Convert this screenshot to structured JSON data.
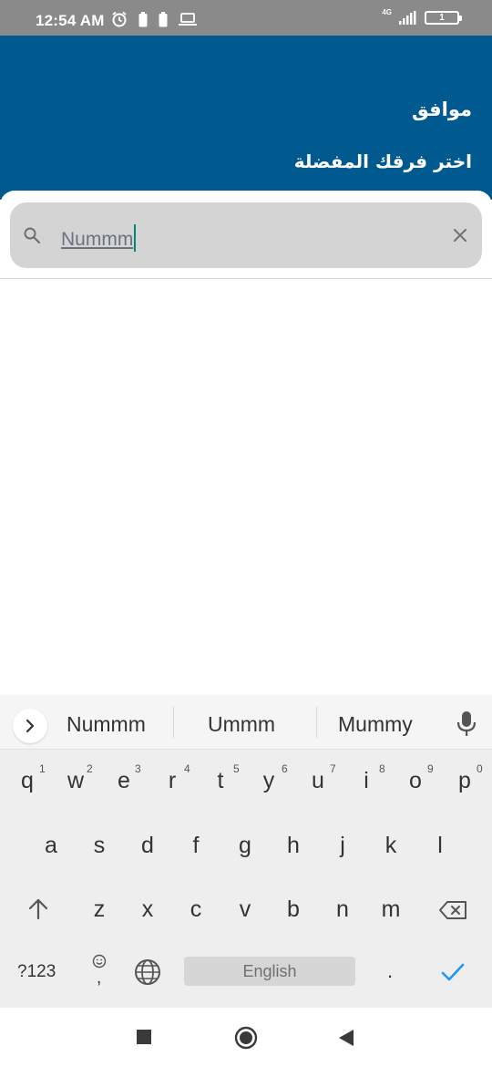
{
  "status_bar": {
    "time": "12:54 AM",
    "network": "4G",
    "battery_level": "1",
    "icons": [
      "alarm-icon",
      "battery-saver-icon",
      "battery-saver-icon",
      "laptop-icon",
      "signal-icon",
      "battery-icon"
    ]
  },
  "header": {
    "ok_label": "موافق",
    "subtitle": "اختر فرقك المفضلة",
    "color": "#005a8f"
  },
  "search": {
    "value": "Nummm",
    "icon": "search-icon",
    "clear_icon": "close-icon"
  },
  "keyboard": {
    "suggestions": [
      "Nummm",
      "Ummm",
      "Mummy"
    ],
    "row1": [
      "q",
      "w",
      "e",
      "r",
      "t",
      "y",
      "u",
      "i",
      "o",
      "p"
    ],
    "row1_hints": [
      "1",
      "2",
      "3",
      "4",
      "5",
      "6",
      "7",
      "8",
      "9",
      "0"
    ],
    "row2": [
      "a",
      "s",
      "d",
      "f",
      "g",
      "h",
      "j",
      "k",
      "l"
    ],
    "row3": [
      "z",
      "x",
      "c",
      "v",
      "b",
      "n",
      "m"
    ],
    "symbols_label": "?123",
    "comma_label": ",",
    "period_label": ".",
    "space_label": "English",
    "enter_color": "#2196f3"
  }
}
